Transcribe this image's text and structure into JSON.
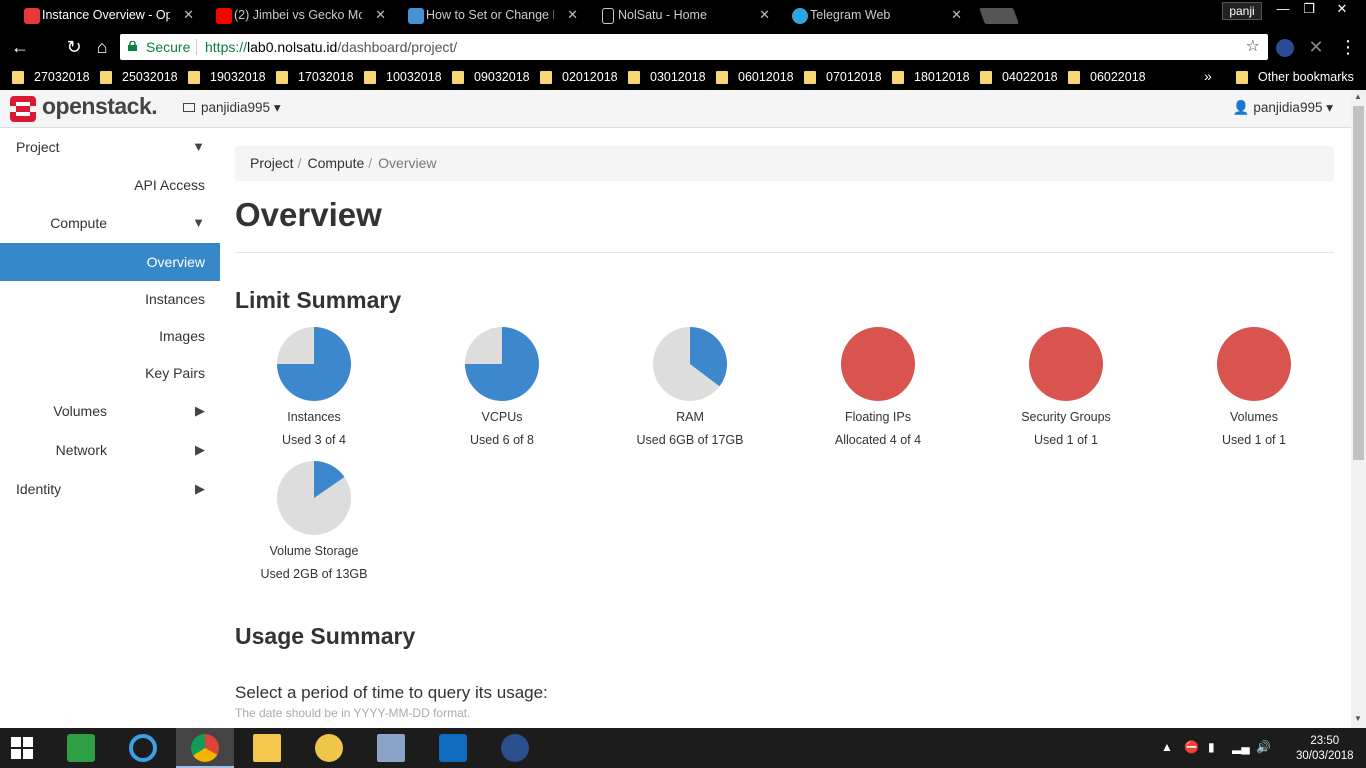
{
  "browser": {
    "tabs": [
      {
        "title": "Instance Overview - Ope",
        "active": true,
        "favicon_color": "#e53935"
      },
      {
        "title": "(2) Jimbei vs Gecko Mori",
        "active": false,
        "favicon_color": "#ff0000"
      },
      {
        "title": "How to Set or Change H",
        "active": false,
        "favicon_color": "#4a90d9"
      },
      {
        "title": "NolSatu - Home",
        "active": false,
        "favicon_color": "#cccccc"
      },
      {
        "title": "Telegram Web",
        "active": false,
        "favicon_color": "#2ca5e0"
      }
    ],
    "window_user": "panji",
    "omnibox": {
      "secure_label": "Secure",
      "url_scheme": "https://",
      "url_host": "lab0.nolsatu.id",
      "url_path": "/dashboard/project/"
    },
    "bookmarks": [
      "27032018",
      "25032018",
      "19032018",
      "17032018",
      "10032018",
      "09032018",
      "02012018",
      "03012018",
      "06012018",
      "07012018",
      "18012018",
      "04022018",
      "06022018"
    ],
    "bookmarks_more": "»",
    "other_bookmarks": "Other bookmarks"
  },
  "header": {
    "brand": "openstack.",
    "project": "panjidia995 ▾",
    "user": "panjidia995 ▾"
  },
  "sidebar": {
    "project": "Project",
    "api_access": "API Access",
    "compute": "Compute",
    "overview": "Overview",
    "instances": "Instances",
    "images": "Images",
    "key_pairs": "Key Pairs",
    "volumes": "Volumes",
    "network": "Network",
    "identity": "Identity"
  },
  "breadcrumb": {
    "b1": "Project",
    "b2": "Compute",
    "b3": "Overview",
    "sep": "/"
  },
  "page": {
    "title": "Overview",
    "limit_summary": "Limit Summary",
    "usage_summary": "Usage Summary",
    "query_text": "Select a period of time to query its usage:",
    "help_text": "The date should be in YYYY-MM-DD format."
  },
  "colors": {
    "used": "#3d87cc",
    "free": "#dddddd",
    "full": "#d9534f",
    "active_nav": "#3788c9"
  },
  "chart_data": {
    "type": "pie",
    "charts": [
      {
        "label": "Instances",
        "used_text": "Used 3 of 4",
        "used": 3,
        "total": 4
      },
      {
        "label": "VCPUs",
        "used_text": "Used 6 of 8",
        "used": 6,
        "total": 8
      },
      {
        "label": "RAM",
        "used_text": "Used 6GB of 17GB",
        "used": 6,
        "total": 17
      },
      {
        "label": "Floating IPs",
        "used_text": "Allocated 4 of 4",
        "used": 4,
        "total": 4
      },
      {
        "label": "Security Groups",
        "used_text": "Used 1 of 1",
        "used": 1,
        "total": 1
      },
      {
        "label": "Volumes",
        "used_text": "Used 1 of 1",
        "used": 1,
        "total": 1
      },
      {
        "label": "Volume Storage",
        "used_text": "Used 2GB of 13GB",
        "used": 2,
        "total": 13
      }
    ]
  },
  "taskbar": {
    "clock_time": "23:50",
    "clock_date": "30/03/2018"
  }
}
